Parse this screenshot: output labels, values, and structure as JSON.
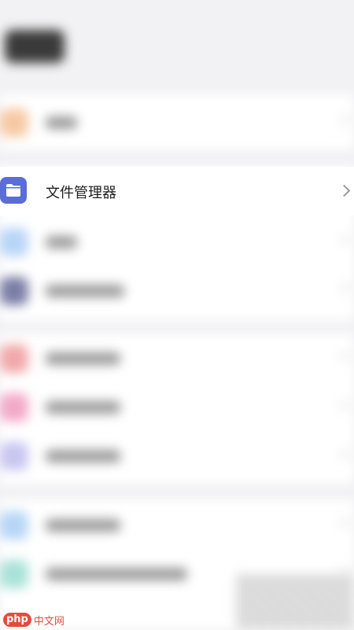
{
  "header": {
    "title": "设置"
  },
  "focused_item": {
    "label": "文件管理器",
    "icon": "folder-icon",
    "icon_color": "#5b6dd6"
  },
  "blurred_items": [
    {
      "icon_color": "#f6c9a3"
    },
    {
      "icon_color": "#b7d5f7"
    },
    {
      "icon_color": "#7b7ea6"
    },
    {
      "icon_color": "#f2a8aa"
    },
    {
      "icon_color": "#f3a9c8"
    },
    {
      "icon_color": "#c9c6f0"
    },
    {
      "icon_color": "#b6d6f6"
    },
    {
      "icon_color": "#a9e2d8"
    }
  ],
  "watermark": {
    "badge": "php",
    "text": "中文网"
  }
}
